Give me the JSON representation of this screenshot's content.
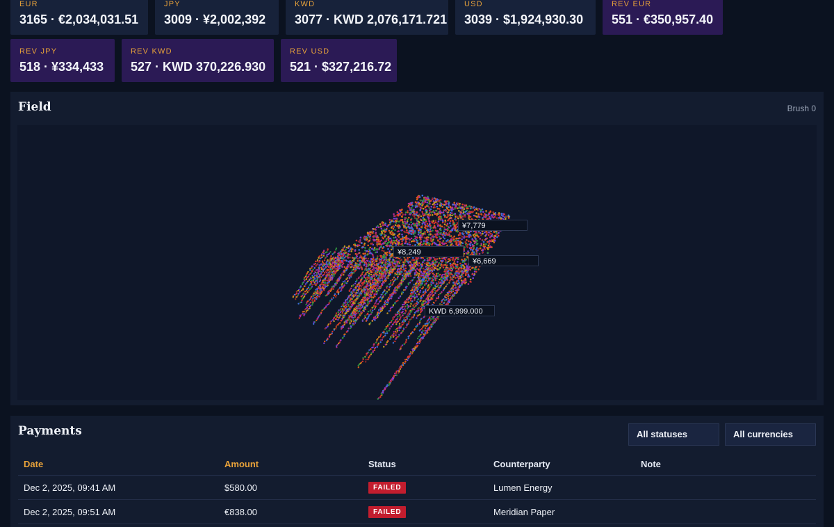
{
  "kpi_tiles_row1": [
    {
      "label": "EUR",
      "value": "3165 · €2,034,031.51",
      "width": 198
    },
    {
      "label": "JPY",
      "value": "3009 · ¥2,002,392",
      "width": 178
    },
    {
      "label": "KWD",
      "value": "3077 · KWD 2,076,171.721",
      "width": 234
    },
    {
      "label": "USD",
      "value": "3039 · $1,924,930.30",
      "width": 202
    },
    {
      "label": "REV EUR",
      "value": "551 · €350,957.40",
      "width": 173
    }
  ],
  "kpi_tiles_row2": [
    {
      "label": "REV JPY",
      "value": "518 · ¥334,433",
      "width": 150
    },
    {
      "label": "REV KWD",
      "value": "527 · KWD 370,226.930",
      "width": 219
    },
    {
      "label": "REV USD",
      "value": "521 · $327,216.72",
      "width": 167
    }
  ],
  "field": {
    "title": "Field",
    "brush": "Brush 0",
    "tooltips": [
      {
        "text": "¥7,779"
      },
      {
        "text": "¥8,249"
      },
      {
        "text": "¥6,669"
      },
      {
        "text": "KWD 6,999.000"
      }
    ]
  },
  "payments": {
    "title": "Payments",
    "filter_status": "All statuses",
    "filter_currency": "All currencies",
    "columns": [
      "Date",
      "Amount",
      "Status",
      "Counterparty",
      "Note"
    ],
    "rows": [
      {
        "date": "Dec 2, 2025, 09:41 AM",
        "amount": "$580.00",
        "status": "FAILED",
        "counterparty": "Lumen Energy",
        "note": ""
      },
      {
        "date": "Dec 2, 2025, 09:51 AM",
        "amount": "€838.00",
        "status": "FAILED",
        "counterparty": "Meridian Paper",
        "note": ""
      }
    ]
  },
  "colors": {
    "accent": "#e8a23a",
    "failed": "#c21d2e",
    "tile": "#17223a",
    "tile_rev": "#2b1a55"
  }
}
